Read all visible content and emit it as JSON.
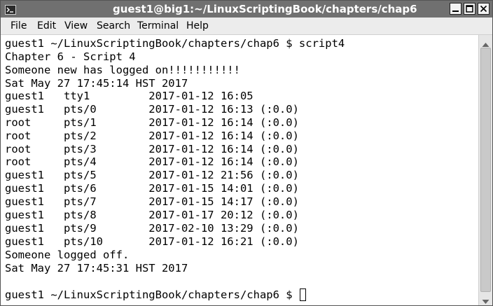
{
  "window": {
    "title": "guest1@big1:~/LinuxScriptingBook/chapters/chap6"
  },
  "menubar": {
    "items": [
      "File",
      "Edit",
      "View",
      "Search",
      "Terminal",
      "Help"
    ]
  },
  "terminal": {
    "lines": [
      "guest1 ~/LinuxScriptingBook/chapters/chap6 $ script4",
      "Chapter 6 - Script 4",
      "Someone new has logged on!!!!!!!!!!!",
      "Sat May 27 17:45:14 HST 2017",
      "guest1   tty1         2017-01-12 16:05",
      "guest1   pts/0        2017-01-12 16:13 (:0.0)",
      "root     pts/1        2017-01-12 16:14 (:0.0)",
      "root     pts/2        2017-01-12 16:14 (:0.0)",
      "root     pts/3        2017-01-12 16:14 (:0.0)",
      "root     pts/4        2017-01-12 16:14 (:0.0)",
      "guest1   pts/5        2017-01-12 21:56 (:0.0)",
      "guest1   pts/6        2017-01-15 14:01 (:0.0)",
      "guest1   pts/7        2017-01-15 14:17 (:0.0)",
      "guest1   pts/8        2017-01-17 20:12 (:0.0)",
      "guest1   pts/9        2017-02-10 13:29 (:0.0)",
      "guest1   pts/10       2017-01-12 16:21 (:0.0)",
      "Someone logged off.",
      "Sat May 27 17:45:31 HST 2017",
      "",
      "guest1 ~/LinuxScriptingBook/chapters/chap6 $ "
    ]
  },
  "colors": {
    "titlebar": "#707070",
    "title_text": "#ffffff",
    "menubar": "#ececec",
    "terminal_bg": "#ffffff",
    "terminal_fg": "#000000"
  },
  "icons": {
    "app": "terminal-icon",
    "minimize": "minimize-icon",
    "maximize": "maximize-icon",
    "close": "close-icon"
  }
}
